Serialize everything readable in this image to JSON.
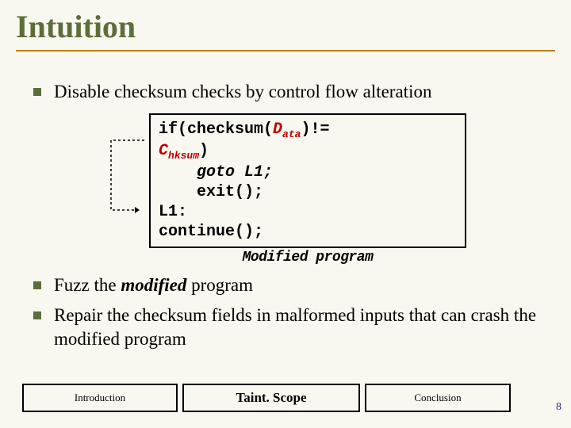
{
  "title": "Intuition",
  "bullets": {
    "b1": "Disable checksum checks by control flow alteration",
    "b2_pre": "Fuzz the ",
    "b2_em": "modified",
    "b2_post": " program",
    "b3": "Repair the checksum fields in malformed inputs that can crash the modified program"
  },
  "code": {
    "l1a": "if(checksum(",
    "l1b": "D",
    "l1bsub": "ata",
    "l1c": ")!=",
    "l2a": "C",
    "l2asub": "hksum",
    "l2b": ")",
    "l3": "goto L1;",
    "l4": "exit();",
    "l5": "L1:",
    "l6": "continue();",
    "caption": "Modified program"
  },
  "footer": {
    "intro": "Introduction",
    "scope": "Taint. Scope",
    "concl": "Conclusion"
  },
  "page": "8"
}
